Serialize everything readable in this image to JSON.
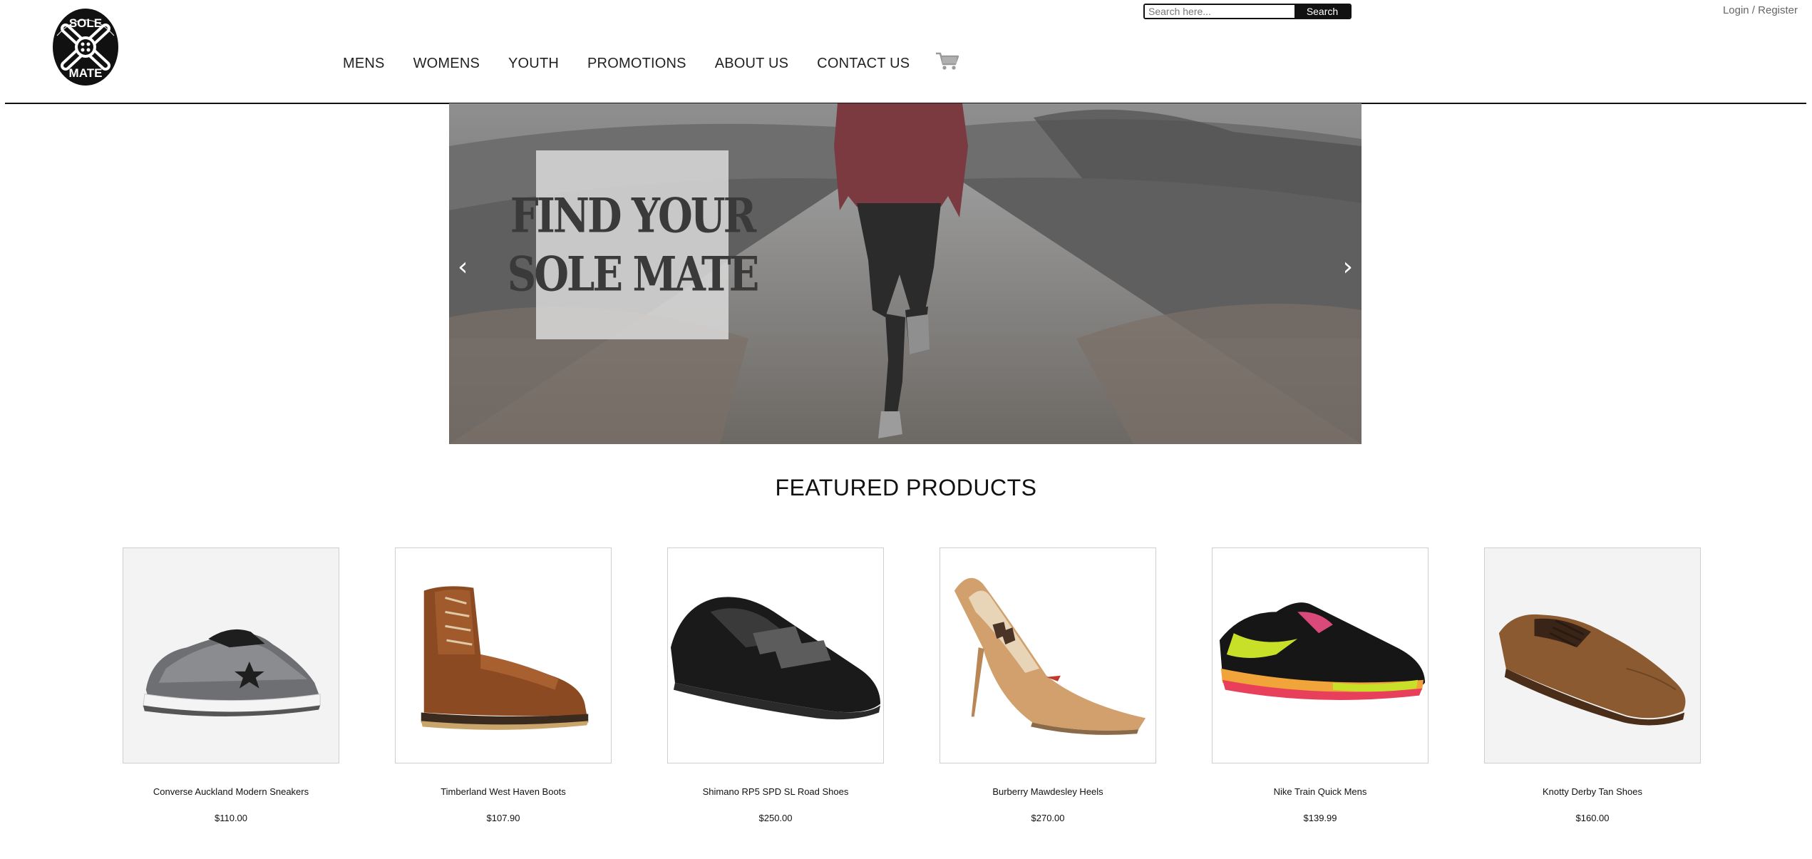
{
  "brand": {
    "logo_text_top": "SOLE",
    "logo_text_bottom": "MATE"
  },
  "search": {
    "placeholder": "Search here...",
    "button_label": "Search"
  },
  "account": {
    "login_label": "Login / Register"
  },
  "nav": {
    "items": [
      {
        "label": "MENS"
      },
      {
        "label": "WOMENS"
      },
      {
        "label": "YOUTH"
      },
      {
        "label": "PROMOTIONS"
      },
      {
        "label": "ABOUT US"
      },
      {
        "label": "CONTACT US"
      }
    ],
    "cart_icon": "shopping-cart-icon"
  },
  "hero": {
    "line1": "FIND YOUR",
    "line2": "SOLE MATE",
    "prev_label": "‹",
    "next_label": "›"
  },
  "featured": {
    "title": "FEATURED PRODUCTS",
    "products": [
      {
        "name": "Converse Auckland Modern Sneakers",
        "price": "$110.00"
      },
      {
        "name": "Timberland West Haven Boots",
        "price": "$107.90"
      },
      {
        "name": "Shimano RP5 SPD SL Road Shoes",
        "price": "$250.00"
      },
      {
        "name": "Burberry Mawdesley Heels",
        "price": "$270.00"
      },
      {
        "name": "Nike Train Quick Mens",
        "price": "$139.99"
      },
      {
        "name": "Knotty Derby Tan Shoes",
        "price": "$160.00"
      }
    ]
  },
  "colors": {
    "accent": "#111111",
    "border": "#cfcfcf",
    "muted_text": "#666666"
  }
}
